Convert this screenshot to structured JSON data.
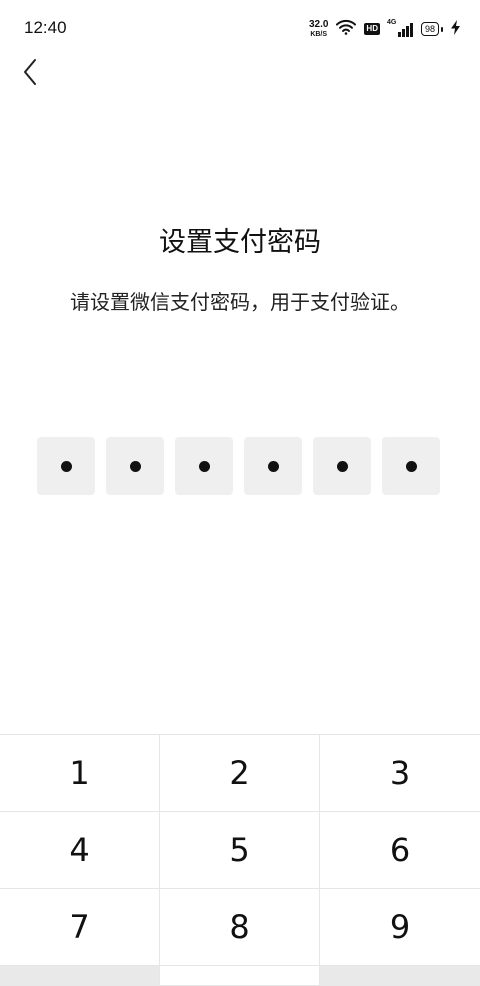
{
  "status_bar": {
    "time": "12:40",
    "net_speed_value": "32.0",
    "net_speed_unit": "KB/S",
    "hd_label": "HD",
    "network_type": "4G",
    "battery_level": "98"
  },
  "page": {
    "title": "设置支付密码",
    "subtitle": "请设置微信支付密码，用于支付验证。"
  },
  "pin": {
    "length": 6,
    "filled": 6
  },
  "keypad": {
    "keys": [
      "1",
      "2",
      "3",
      "4",
      "5",
      "6",
      "7",
      "8",
      "9"
    ]
  },
  "icons": {
    "back": "chevron-left-icon",
    "wifi": "wifi-icon",
    "signal": "signal-icon",
    "battery": "battery-icon",
    "charging": "charging-bolt-icon"
  }
}
